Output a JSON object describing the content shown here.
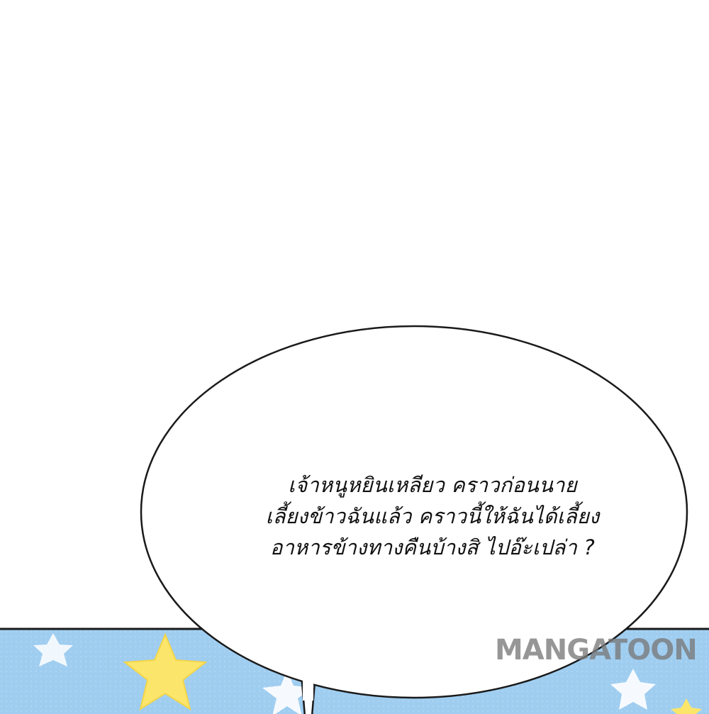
{
  "speech_bubble": {
    "lines": [
      "เจ้าหนูหยินเหลียว คราวก่อนนาย",
      "เลี้ยงข้าวฉันแล้ว คราวนี้ให้ฉันได้เลี้ยง",
      "อาหารข้างทางคืนบ้างสิ ไปอ๊ะเปล่า ?"
    ]
  },
  "watermark": {
    "text": "MANGATOON"
  },
  "colors": {
    "page_background": "#ffffff",
    "sky_blue": "#9fcdf0",
    "star_yellow": "#fbe66b",
    "star_white": "#ffffff",
    "outline": "#1a1a1a"
  }
}
